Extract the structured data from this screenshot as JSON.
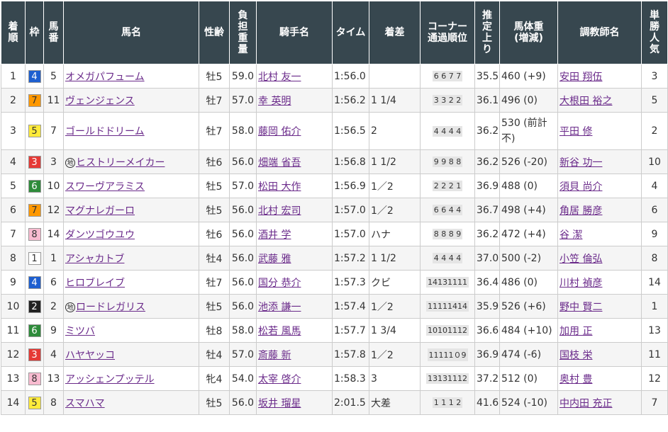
{
  "headers": [
    "着順",
    "枠",
    "馬番",
    "馬名",
    "性齢",
    "負担重量",
    "騎手名",
    "タイム",
    "着差",
    "コーナー通過順位",
    "推定上り",
    "馬体重(増減)",
    "調教師名",
    "単勝人気"
  ],
  "header_lines": {
    "rank": "着順",
    "waku": "枠",
    "umaban": "馬番",
    "horse": "馬名",
    "sexage": "性齢",
    "weight": "負担重量",
    "jockey": "騎手名",
    "time": "タイム",
    "margin": "着差",
    "corner_1": "コーナー",
    "corner_2": "通過順位",
    "last3f": "推定上り",
    "bodyweight_1": "馬体重",
    "bodyweight_2": "(増減)",
    "trainer": "調教師名",
    "pop": "単勝人気"
  },
  "rows": [
    {
      "rank": "1",
      "waku": "4",
      "umaban": "5",
      "horse": "オメガパフューム",
      "maru": "",
      "sexage": "牡5",
      "weight": "59.0",
      "jockey": "北村 友一",
      "time": "1:56.0",
      "margin": "",
      "corner": "6 6 7 7",
      "last3f": "35.5",
      "bodyweight": "460 (+9)",
      "trainer": "安田 翔伍",
      "pop": "3"
    },
    {
      "rank": "2",
      "waku": "7",
      "umaban": "11",
      "horse": "ヴェンジェンス",
      "maru": "",
      "sexage": "牡7",
      "weight": "57.0",
      "jockey": "幸 英明",
      "time": "1:56.2",
      "margin": "1 1/4",
      "corner": "3 3 2 2",
      "last3f": "36.1",
      "bodyweight": "496 (0)",
      "trainer": "大根田 裕之",
      "pop": "5"
    },
    {
      "rank": "3",
      "waku": "5",
      "umaban": "7",
      "horse": "ゴールドドリーム",
      "maru": "",
      "sexage": "牡7",
      "weight": "58.0",
      "jockey": "藤岡 佑介",
      "time": "1:56.5",
      "margin": "2",
      "corner": "4 4 4 4",
      "last3f": "36.2",
      "bodyweight": "530 (前計不)",
      "trainer": "平田 修",
      "pop": "2"
    },
    {
      "rank": "4",
      "waku": "3",
      "umaban": "3",
      "horse": "ヒストリーメイカー",
      "maru": "地",
      "sexage": "牡6",
      "weight": "56.0",
      "jockey": "畑端 省吾",
      "time": "1:56.8",
      "margin": "1 1/2",
      "corner": "9 9 8 8",
      "last3f": "36.2",
      "bodyweight": "526 (-20)",
      "trainer": "新谷 功一",
      "pop": "10"
    },
    {
      "rank": "5",
      "waku": "6",
      "umaban": "10",
      "horse": "スワーヴアラミス",
      "maru": "",
      "sexage": "牡5",
      "weight": "57.0",
      "jockey": "松田 大作",
      "time": "1:56.9",
      "margin": "1／2",
      "corner": "2 2 2 1",
      "last3f": "36.9",
      "bodyweight": "488 (0)",
      "trainer": "須貝 尚介",
      "pop": "4"
    },
    {
      "rank": "6",
      "waku": "7",
      "umaban": "12",
      "horse": "マグナレガーロ",
      "maru": "",
      "sexage": "牡5",
      "weight": "56.0",
      "jockey": "北村 宏司",
      "time": "1:57.0",
      "margin": "1／2",
      "corner": "6 6 4 4",
      "last3f": "36.7",
      "bodyweight": "498 (+4)",
      "trainer": "角居 勝彦",
      "pop": "6"
    },
    {
      "rank": "7",
      "waku": "8",
      "umaban": "14",
      "horse": "ダンツゴウユウ",
      "maru": "",
      "sexage": "牡6",
      "weight": "56.0",
      "jockey": "酒井 学",
      "time": "1:57.0",
      "margin": "ハナ",
      "corner": "8 8 8 9",
      "last3f": "36.2",
      "bodyweight": "472 (+4)",
      "trainer": "谷 潔",
      "pop": "9"
    },
    {
      "rank": "8",
      "waku": "1",
      "umaban": "1",
      "horse": "アシャカトブ",
      "maru": "",
      "sexage": "牡4",
      "weight": "56.0",
      "jockey": "武藤 雅",
      "time": "1:57.2",
      "margin": "1 1/2",
      "corner": "4 4 4 4",
      "last3f": "37.0",
      "bodyweight": "500 (-2)",
      "trainer": "小笠 倫弘",
      "pop": "8"
    },
    {
      "rank": "9",
      "waku": "4",
      "umaban": "6",
      "horse": "ヒロブレイブ",
      "maru": "",
      "sexage": "牡7",
      "weight": "56.0",
      "jockey": "国分 恭介",
      "time": "1:57.3",
      "margin": "クビ",
      "corner": "14131111",
      "last3f": "36.4",
      "bodyweight": "486 (0)",
      "trainer": "川村 禎彦",
      "pop": "14"
    },
    {
      "rank": "10",
      "waku": "2",
      "umaban": "2",
      "horse": "ロードレガリス",
      "maru": "地",
      "sexage": "牡5",
      "weight": "56.0",
      "jockey": "池添 謙一",
      "time": "1:57.4",
      "margin": "1／2",
      "corner": "11111414",
      "last3f": "35.9",
      "bodyweight": "526 (+6)",
      "trainer": "野中 賢二",
      "pop": "1"
    },
    {
      "rank": "11",
      "waku": "6",
      "umaban": "9",
      "horse": "ミツバ",
      "maru": "",
      "sexage": "牡8",
      "weight": "58.0",
      "jockey": "松若 風馬",
      "time": "1:57.7",
      "margin": "1 3/4",
      "corner": "10101112",
      "last3f": "36.6",
      "bodyweight": "484 (+10)",
      "trainer": "加用 正",
      "pop": "13"
    },
    {
      "rank": "12",
      "waku": "3",
      "umaban": "4",
      "horse": "ハヤヤッコ",
      "maru": "",
      "sexage": "牡4",
      "weight": "57.0",
      "jockey": "斎藤 新",
      "time": "1:57.8",
      "margin": "1／2",
      "corner": "11111０9",
      "last3f": "36.9",
      "bodyweight": "474 (-6)",
      "trainer": "国枝 栄",
      "pop": "11"
    },
    {
      "rank": "13",
      "waku": "8",
      "umaban": "13",
      "horse": "アッシェンプッテル",
      "maru": "",
      "sexage": "牝4",
      "weight": "54.0",
      "jockey": "太宰 啓介",
      "time": "1:58.3",
      "margin": "3",
      "corner": "13131112",
      "last3f": "37.2",
      "bodyweight": "512 (0)",
      "trainer": "奥村 豊",
      "pop": "12"
    },
    {
      "rank": "14",
      "waku": "5",
      "umaban": "8",
      "horse": "スマハマ",
      "maru": "",
      "sexage": "牡5",
      "weight": "56.0",
      "jockey": "坂井 瑠星",
      "time": "2:01.5",
      "margin": "大差",
      "corner": "1 1 1 2",
      "last3f": "41.6",
      "bodyweight": "524 (-10)",
      "trainer": "中内田 充正",
      "pop": "7"
    }
  ],
  "waku_colors": {
    "1": {
      "bg": "#ffffff",
      "fg": "#333333"
    },
    "2": {
      "bg": "#222222",
      "fg": "#ffffff"
    },
    "3": {
      "bg": "#e53935",
      "fg": "#ffffff"
    },
    "4": {
      "bg": "#1e5fcf",
      "fg": "#ffffff"
    },
    "5": {
      "bg": "#ffeb3b",
      "fg": "#333333"
    },
    "6": {
      "bg": "#2e8b3a",
      "fg": "#ffffff"
    },
    "7": {
      "bg": "#ff9800",
      "fg": "#333333"
    },
    "8": {
      "bg": "#f8bbd0",
      "fg": "#333333"
    }
  }
}
